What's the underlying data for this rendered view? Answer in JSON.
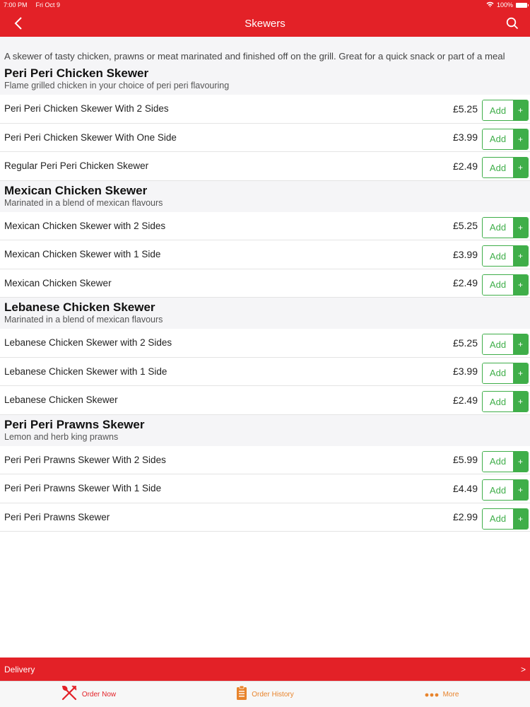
{
  "status_bar": {
    "time": "7:00 PM",
    "date": "Fri Oct 9",
    "battery": "100%"
  },
  "nav": {
    "title": "Skewers"
  },
  "intro_text": "A skewer of tasty chicken, prawns or meat marinated and finished off on the grill. Great for a quick snack or part of a meal",
  "add_label": "Add",
  "plus_label": "+",
  "sections": [
    {
      "title": "Peri Peri Chicken Skewer",
      "subtitle": "Flame grilled chicken in your choice of peri peri flavouring",
      "items": [
        {
          "name": "Peri Peri Chicken Skewer With 2 Sides",
          "price": "£5.25"
        },
        {
          "name": "Peri Peri Chicken Skewer With One Side",
          "price": "£3.99"
        },
        {
          "name": "Regular Peri Peri Chicken Skewer",
          "price": "£2.49"
        }
      ]
    },
    {
      "title": "Mexican Chicken Skewer",
      "subtitle": "Marinated in a blend of mexican flavours",
      "items": [
        {
          "name": "Mexican Chicken Skewer with 2 Sides",
          "price": "£5.25"
        },
        {
          "name": "Mexican Chicken Skewer with 1 Side",
          "price": "£3.99"
        },
        {
          "name": "Mexican Chicken Skewer",
          "price": "£2.49"
        }
      ]
    },
    {
      "title": "Lebanese Chicken Skewer",
      "subtitle": "Marinated in a blend of mexican flavours",
      "items": [
        {
          "name": "Lebanese Chicken Skewer with 2 Sides",
          "price": "£5.25"
        },
        {
          "name": "Lebanese Chicken Skewer with 1 Side",
          "price": "£3.99"
        },
        {
          "name": "Lebanese Chicken Skewer",
          "price": "£2.49"
        }
      ]
    },
    {
      "title": "Peri Peri Prawns Skewer",
      "subtitle": "Lemon and herb king prawns",
      "items": [
        {
          "name": "Peri Peri Prawns Skewer With 2 Sides",
          "price": "£5.99"
        },
        {
          "name": "Peri Peri Prawns Skewer With 1 Side",
          "price": "£4.49"
        },
        {
          "name": "Peri Peri Prawns Skewer",
          "price": "£2.99"
        }
      ]
    }
  ],
  "delivery_bar": {
    "label": "Delivery",
    "chevron": ">"
  },
  "tabs": [
    {
      "label": "Order Now",
      "icon": "fork-knife-icon"
    },
    {
      "label": "Order History",
      "icon": "clipboard-icon"
    },
    {
      "label": "More",
      "icon": "more-dots-icon"
    }
  ],
  "colors": {
    "brand_red": "#e32127",
    "add_green": "#3fae49",
    "tab_orange": "#e8842c"
  }
}
